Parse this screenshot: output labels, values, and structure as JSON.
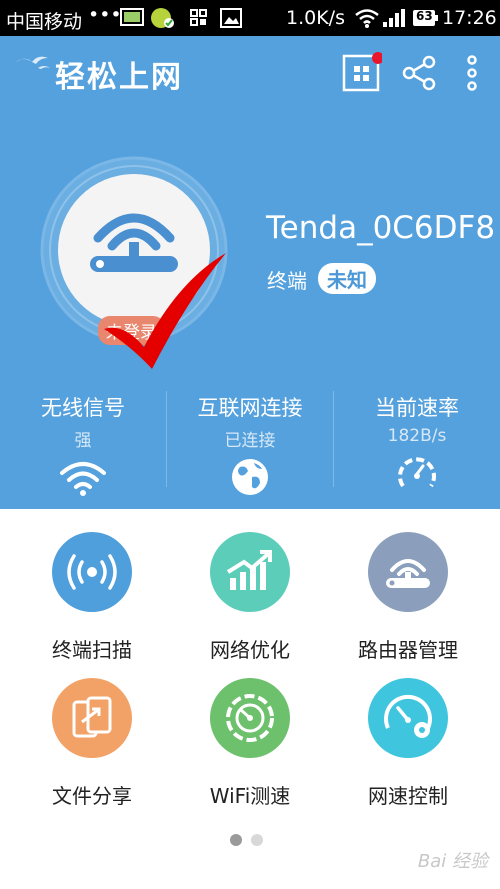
{
  "status_bar": {
    "carrier": "中国移动",
    "dots": "•••",
    "network_speed": "1.0K/s",
    "battery": "63",
    "time": "17:26"
  },
  "app": {
    "title": "轻松上网",
    "menu_icons": [
      "grid-icon",
      "share-icon",
      "more-icon"
    ]
  },
  "router": {
    "login_status": "未登录",
    "ssid": "Tenda_0C6DF8",
    "terminal_label": "终端",
    "terminal_value": "未知"
  },
  "stats": [
    {
      "name": "无线信号",
      "value": "强",
      "icon": "wifi-icon"
    },
    {
      "name": "互联网连接",
      "value": "已连接",
      "icon": "globe-icon"
    },
    {
      "name": "当前速率",
      "value": "182B/s",
      "icon": "speedometer-icon"
    }
  ],
  "tiles": [
    {
      "label": "终端扫描",
      "icon": "scan-icon",
      "color": "#4e9fdc"
    },
    {
      "label": "网络优化",
      "icon": "optimize-icon",
      "color": "#5ccdb9"
    },
    {
      "label": "路由器管理",
      "icon": "router-icon",
      "color": "#8b9fbd"
    },
    {
      "label": "文件分享",
      "icon": "file-share-icon",
      "color": "#f2a266"
    },
    {
      "label": "WiFi测速",
      "icon": "speed-test-icon",
      "color": "#6dc06c"
    },
    {
      "label": "网速控制",
      "icon": "speed-control-icon",
      "color": "#3fc6de"
    }
  ],
  "colors": {
    "primary": "#55a1dd",
    "notification": "#e8152c",
    "check": "#e00000"
  },
  "pager": {
    "pages": 2,
    "current": 1
  },
  "watermark": "Bai 经验"
}
